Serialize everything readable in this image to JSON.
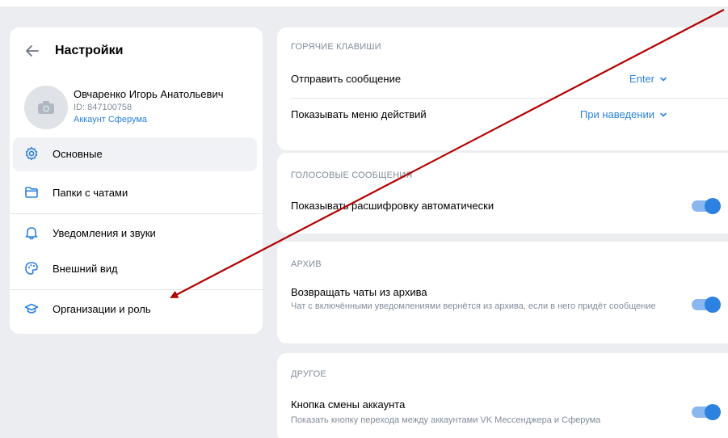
{
  "settings": {
    "title": "Настройки",
    "profile": {
      "name": "Овчаренко Игорь Анатольевич",
      "id_text": "ID: 847100758",
      "account_link": "Аккаунт Сферума"
    },
    "menu": [
      {
        "label": "Основные",
        "icon": "gear-icon",
        "active": true
      },
      {
        "label": "Папки с чатами",
        "icon": "folder-icon",
        "active": false
      },
      {
        "label": "Уведомления и звуки",
        "icon": "bell-icon",
        "active": false
      },
      {
        "label": "Внешний вид",
        "icon": "palette-icon",
        "active": false
      },
      {
        "label": "Организации и роль",
        "icon": "graduation-cap-icon",
        "active": false
      }
    ]
  },
  "hotkeys": {
    "header": "ГОРЯЧИЕ КЛАВИШИ",
    "send_label": "Отправить сообщение",
    "send_value": "Enter",
    "menu_label": "Показывать меню действий",
    "menu_value": "При наведении"
  },
  "voice": {
    "header": "ГОЛОСОВЫЕ СООБЩЕНИЯ",
    "transcript_label": "Показывать расшифровку автоматически",
    "transcript_on": true
  },
  "archive": {
    "header": "АРХИВ",
    "return_label": "Возвращать чаты из архива",
    "return_sub": "Чат с включёнными уведомлениями вернётся из архива, если в него придёт сообщение",
    "return_on": true
  },
  "other": {
    "header": "ДРУГОЕ",
    "switch_label": "Кнопка смены аккаунта",
    "switch_sub": "Показать кнопку перехода между аккаунтами VK Мессенджера и Сферума",
    "switch_on": true
  },
  "colors": {
    "accent": "#2d81e0",
    "background": "#ebedf0",
    "annotation_arrow": "#b30000"
  }
}
